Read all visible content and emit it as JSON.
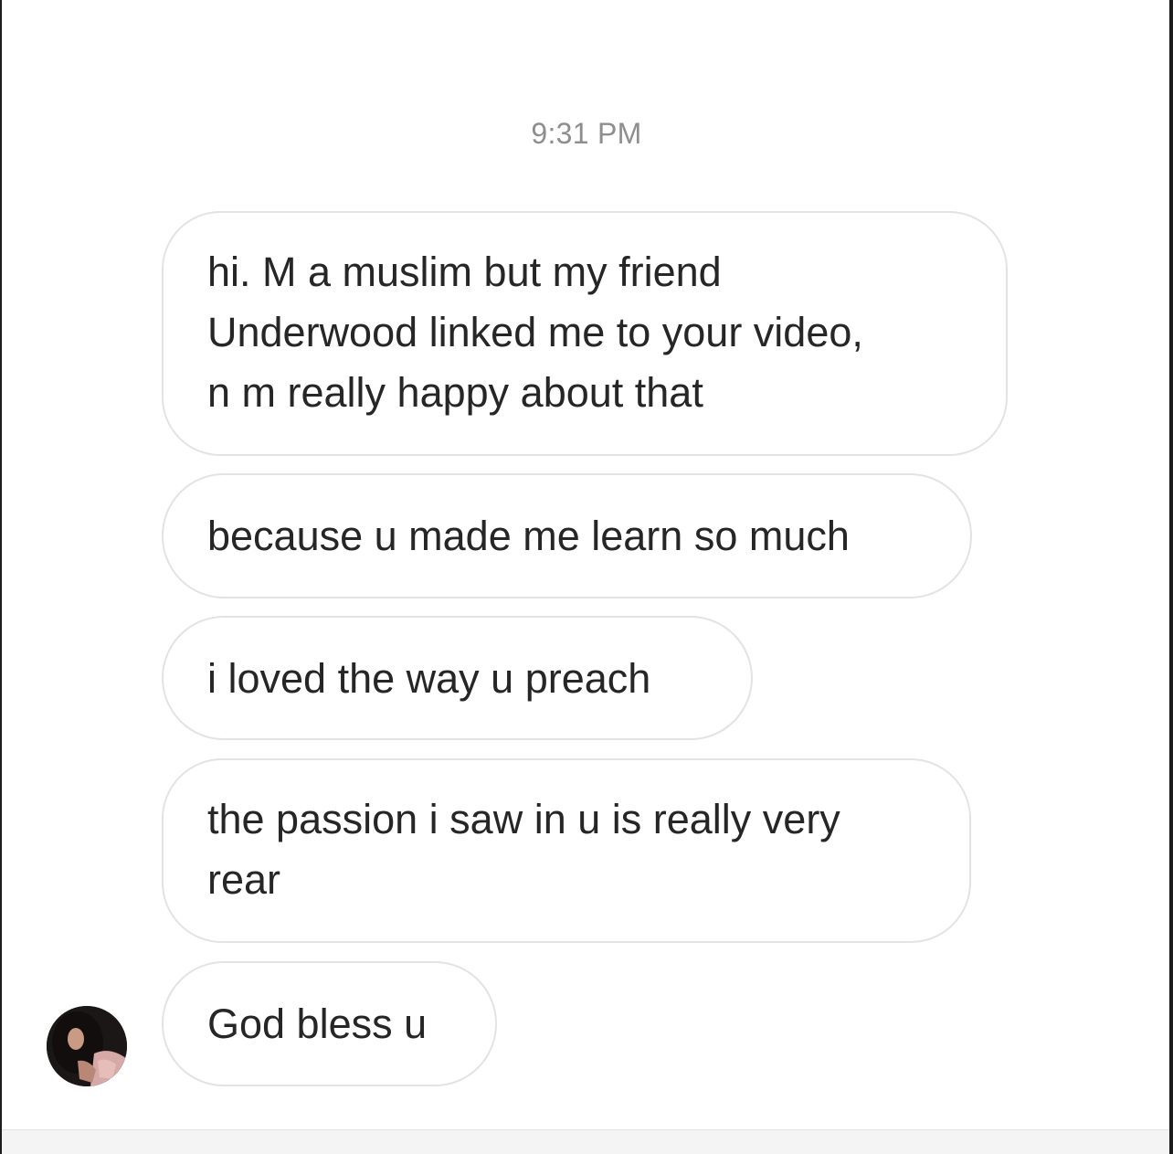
{
  "conversation": {
    "timestamp": "9:31 PM",
    "messages": [
      {
        "lines": [
          "hi. M a muslim but my friend",
          "Underwood linked me to your video,",
          "n m really happy about that"
        ]
      },
      {
        "lines": [
          "because u made me learn so much"
        ]
      },
      {
        "lines": [
          "i loved the way u preach"
        ]
      },
      {
        "lines": [
          "the passion i saw in u is really very",
          "rear"
        ]
      },
      {
        "lines": [
          "God bless u"
        ]
      }
    ],
    "sender_avatar": {
      "icon": "profile-photo-avatar"
    }
  },
  "colors": {
    "background": "#ffffff",
    "bubble_border": "#e3e3e3",
    "message_text": "#262626",
    "timestamp_text": "#8e8e8e"
  }
}
